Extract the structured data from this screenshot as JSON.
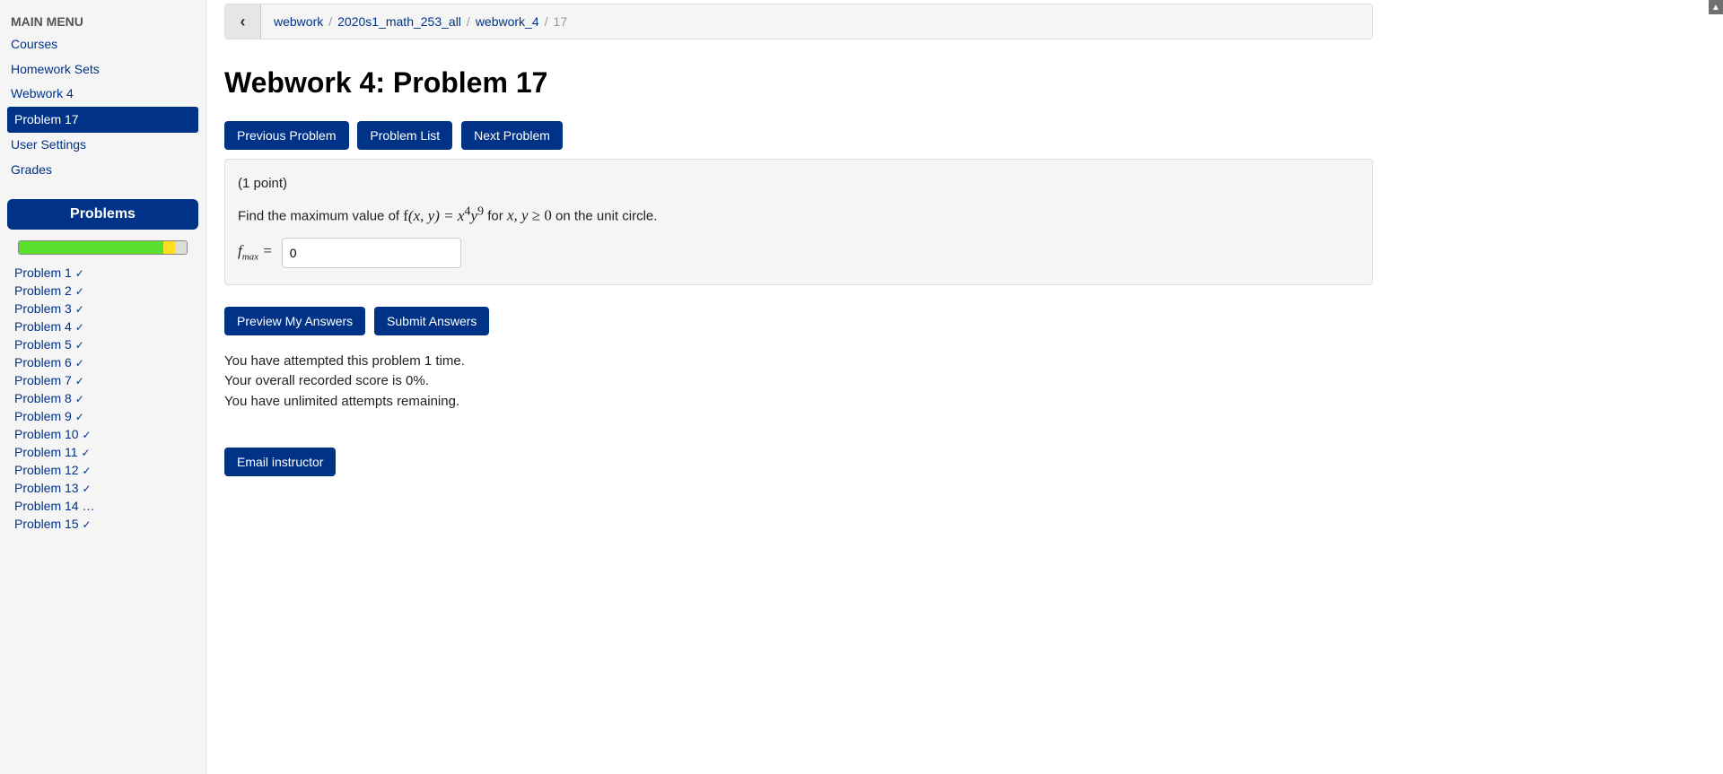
{
  "sidebar": {
    "menu_title": "MAIN MENU",
    "items": {
      "courses": "Courses",
      "homework_sets": "Homework Sets",
      "webwork4": "Webwork 4",
      "problem17": "Problem 17",
      "user_settings": "User Settings",
      "grades": "Grades"
    },
    "problems_header": "Problems",
    "progress": {
      "green_pct": 86,
      "yellow_pct": 7,
      "gray_pct": 7
    },
    "problems": [
      {
        "label": "Problem 1",
        "status": "check"
      },
      {
        "label": "Problem 2",
        "status": "check"
      },
      {
        "label": "Problem 3",
        "status": "check"
      },
      {
        "label": "Problem 4",
        "status": "check"
      },
      {
        "label": "Problem 5",
        "status": "check"
      },
      {
        "label": "Problem 6",
        "status": "check"
      },
      {
        "label": "Problem 7",
        "status": "check"
      },
      {
        "label": "Problem 8",
        "status": "check"
      },
      {
        "label": "Problem 9",
        "status": "check"
      },
      {
        "label": "Problem 10",
        "status": "check"
      },
      {
        "label": "Problem 11",
        "status": "check"
      },
      {
        "label": "Problem 12",
        "status": "check"
      },
      {
        "label": "Problem 13",
        "status": "check"
      },
      {
        "label": "Problem 14",
        "status": "dots"
      },
      {
        "label": "Problem 15",
        "status": "check"
      }
    ]
  },
  "breadcrumb": {
    "back": "‹",
    "items": [
      "webwork",
      "2020s1_math_253_all",
      "webwork_4"
    ],
    "current": "17",
    "sep": "/"
  },
  "page": {
    "title": "Webwork 4: Problem 17",
    "nav": {
      "prev": "Previous Problem",
      "list": "Problem List",
      "next": "Next Problem"
    },
    "problem": {
      "points": "(1 point)",
      "prompt_prefix": "Find the maximum value of ",
      "prompt_mid": " for ",
      "prompt_suffix": " on the unit circle.",
      "f_expr": "f(x, y) = x⁴y⁹",
      "cond": "x, y ≥ 0",
      "answer_label": "f",
      "answer_sub": "max",
      "equals": " = ",
      "answer_value": "0"
    },
    "actions": {
      "preview": "Preview My Answers",
      "submit": "Submit Answers"
    },
    "status": {
      "line1": "You have attempted this problem 1 time.",
      "line2": "Your overall recorded score is 0%.",
      "line3": "You have unlimited attempts remaining."
    },
    "email": "Email instructor"
  }
}
